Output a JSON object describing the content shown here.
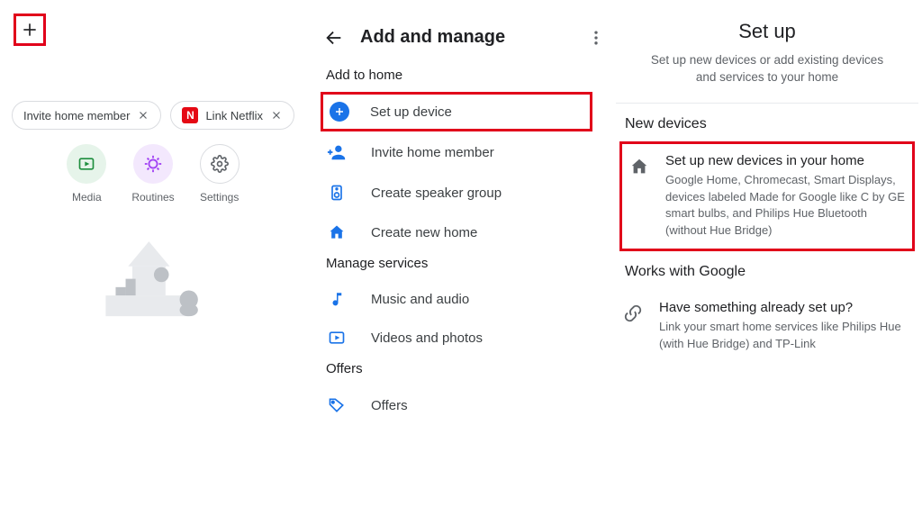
{
  "home": {
    "chips": {
      "invite": "Invite home member",
      "netflix": "Link Netflix",
      "netflix_icon_letter": "N"
    },
    "actions": {
      "media": "Media",
      "routines": "Routines",
      "settings": "Settings"
    }
  },
  "manage": {
    "title": "Add and manage",
    "section_add": "Add to home",
    "setup_device": "Set up device",
    "invite_member": "Invite home member",
    "speaker_group": "Create speaker group",
    "create_home": "Create new home",
    "section_manage": "Manage services",
    "music": "Music and audio",
    "videos": "Videos and photos",
    "section_offers": "Offers",
    "offers": "Offers"
  },
  "setup": {
    "title": "Set up",
    "subtitle": "Set up new devices or add existing devices and services to your home",
    "section_new": "New devices",
    "new_devices_title": "Set up new devices in your home",
    "new_devices_body": "Google Home, Chromecast, Smart Displays, devices labeled Made for Google like C by GE smart bulbs, and Philips Hue Bluetooth (without Hue Bridge)",
    "section_works": "Works with Google",
    "works_title": "Have something already set up?",
    "works_body": "Link your smart home services like Philips Hue (with Hue Bridge) and TP-Link"
  }
}
